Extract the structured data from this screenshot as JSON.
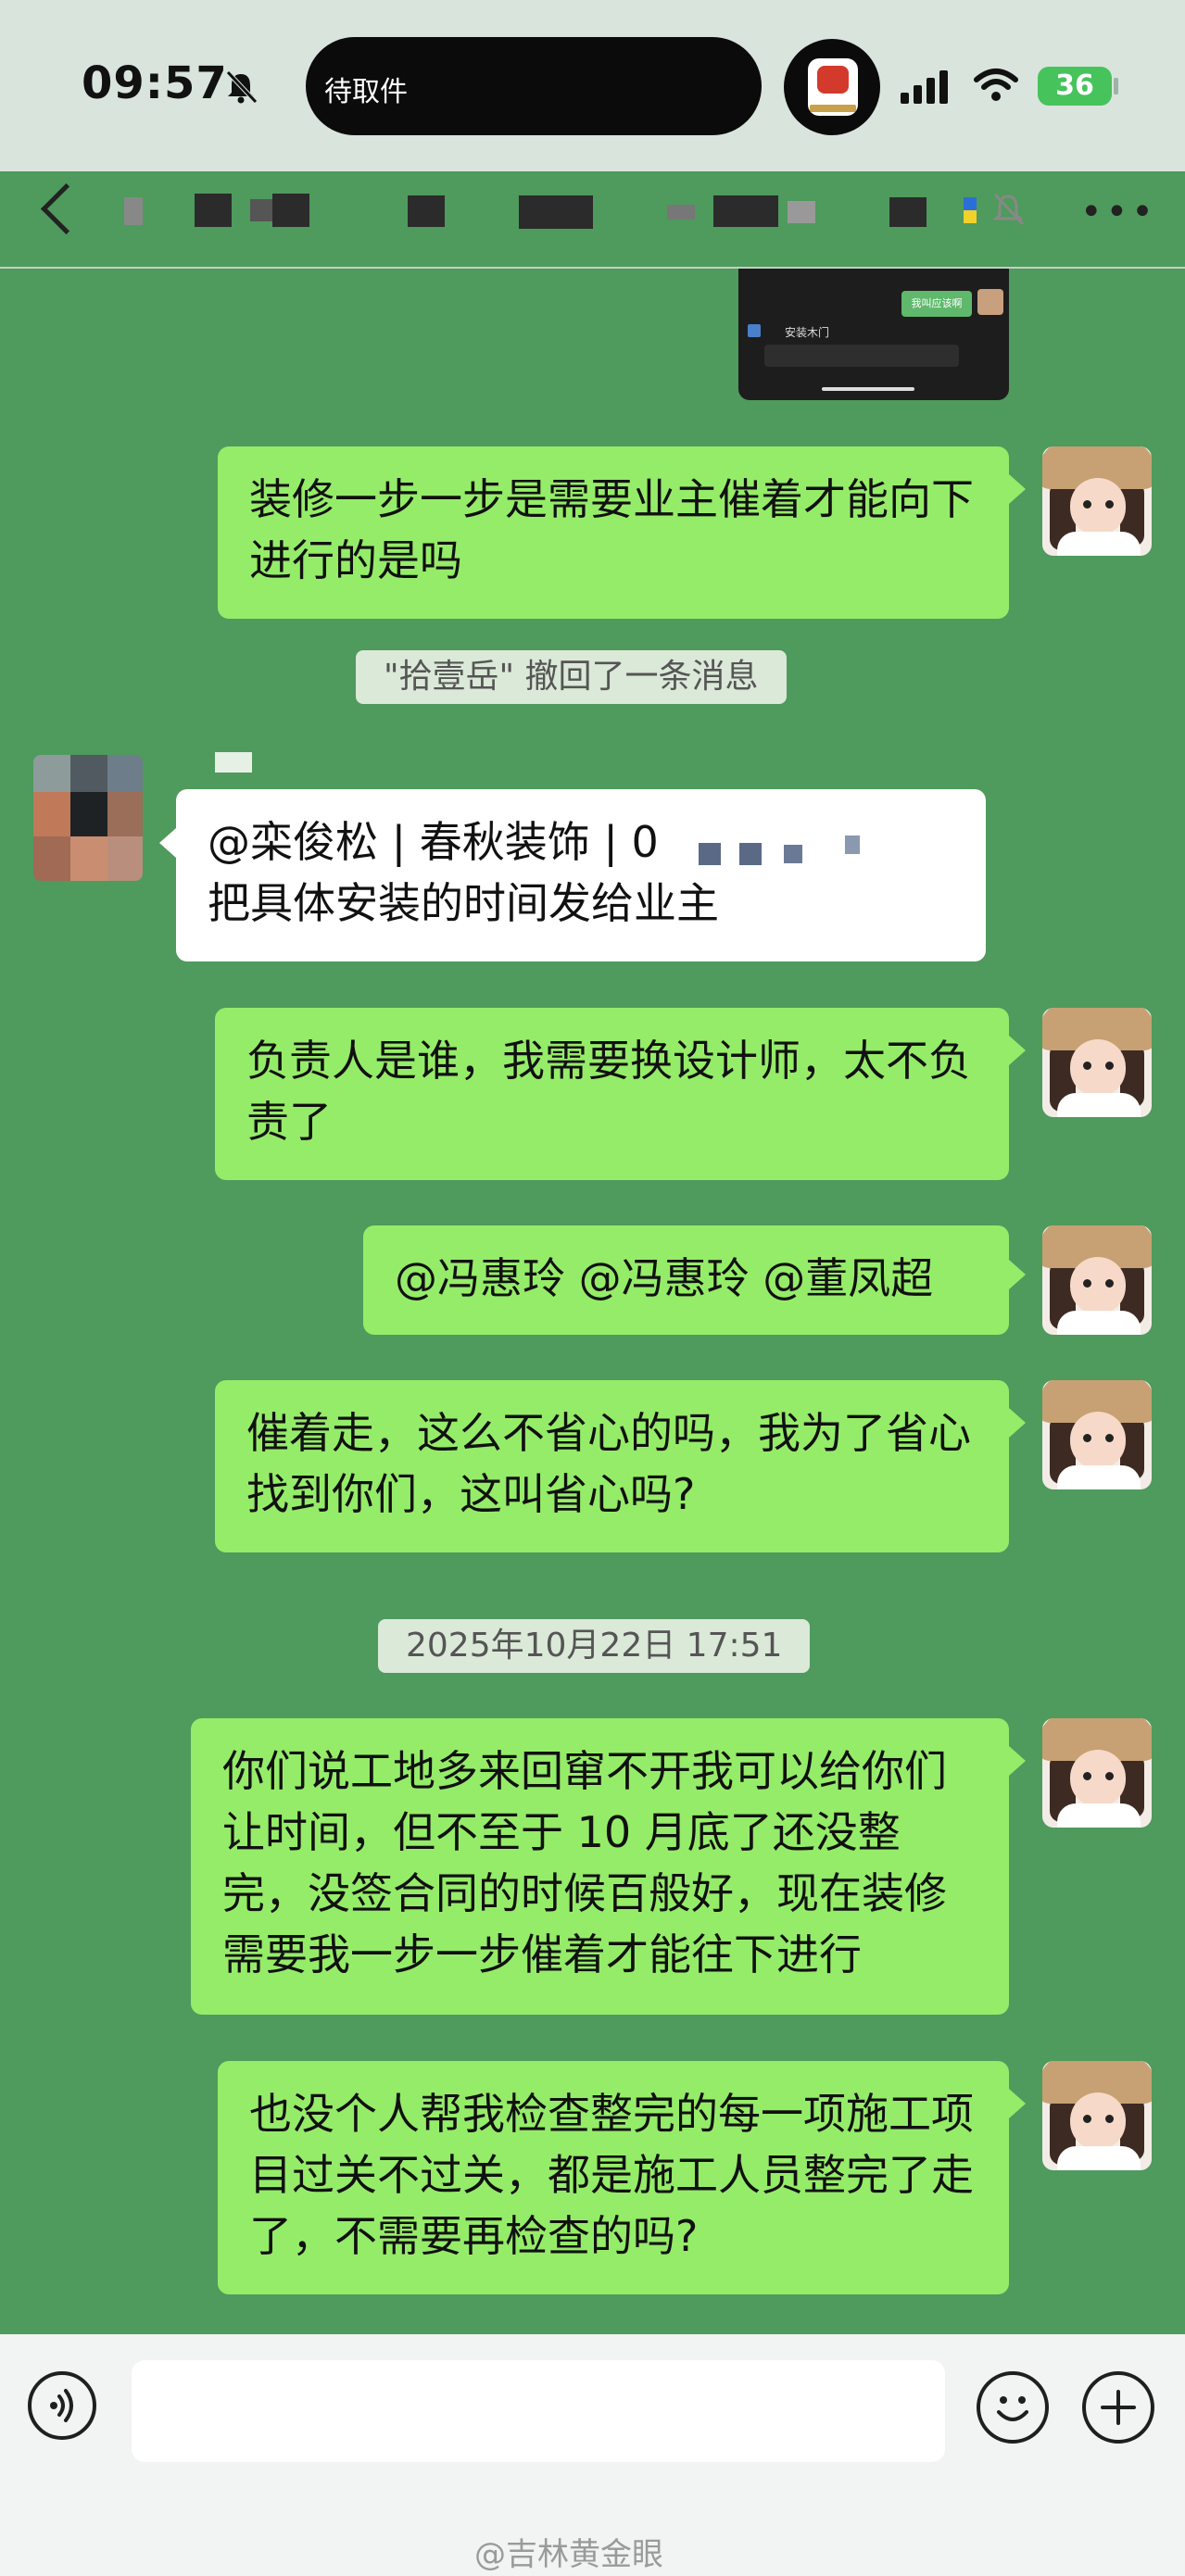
{
  "status_bar": {
    "time": "09:57",
    "island_text": "待取件",
    "battery": "36"
  },
  "messages": [
    {
      "text": "装修一步一步是需要业主催着才能向下进行的是吗"
    },
    {
      "system": "\"拾壹岳\" 撤回了一条消息"
    },
    {
      "text": "@栾俊松 | 春秋装饰 |  0\n把具体安装的时间发给业主"
    },
    {
      "text": "负责人是谁，我需要换设计师，太不负责了"
    },
    {
      "text": "@冯惠玲 @冯惠玲 @董凤超"
    },
    {
      "text": "催着走，这么不省心的吗，我为了省心找到你们，这叫省心吗?"
    },
    {
      "system": "2025年10月22日 17:51"
    },
    {
      "text": "你们说工地多来回窜不开我可以给你们让时间，但不至于 10 月底了还没整完，没签合同的时候百般好，现在装修需要我一步一步催着才能往下进行"
    },
    {
      "text": "也没个人帮我检查整完的每一项施工项目过关不过关，都是施工人员整完了走了，不需要再检查的吗?"
    }
  ],
  "embedded_screenshot": {
    "reply_label": "我叫应该啊",
    "item_label": "安装木门"
  },
  "watermark": "@吉林黄金眼",
  "colors": {
    "chat_background": "#4f9a5d",
    "outgoing_bubble": "#95ec69",
    "incoming_bubble": "#ffffff"
  }
}
